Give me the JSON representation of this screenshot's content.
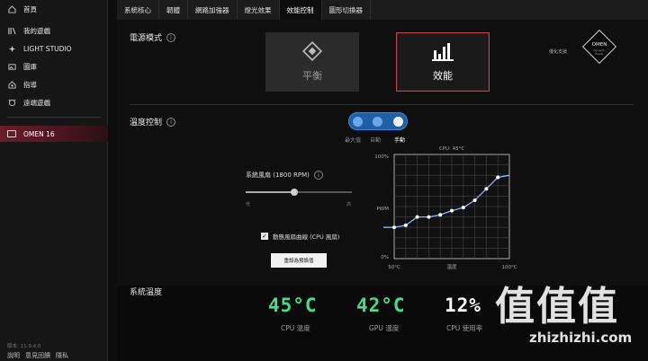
{
  "sidebar": {
    "items": [
      {
        "label": "首頁",
        "icon": "home-icon"
      },
      {
        "label": "我的遊戲",
        "icon": "library-icon"
      },
      {
        "label": "LIGHT STUDIO",
        "icon": "sparkle-icon"
      },
      {
        "label": "圖庫",
        "icon": "gallery-icon"
      },
      {
        "label": "指導",
        "icon": "coach-icon"
      },
      {
        "label": "遠端遊戲",
        "icon": "remote-play-icon"
      }
    ],
    "device": "OMEN 16",
    "version": "版本: 11.9.4.0",
    "footer": [
      "說明",
      "意見回饋",
      "隱私"
    ]
  },
  "tabs": [
    "系統核心",
    "韌體",
    "網路加強器",
    "燈光效果",
    "效能控制",
    "圖形切換器"
  ],
  "active_tab_index": 4,
  "power_mode": {
    "title": "電源模式",
    "cards": [
      {
        "label": "平衡",
        "icon": "diamond-icon",
        "selected": false
      },
      {
        "label": "效能",
        "icon": "performance-bars-icon",
        "selected": true
      }
    ],
    "brand_text": "優化支援",
    "brand_logo_text": "OMEN Dynamic Power"
  },
  "temp_control": {
    "title": "溫度控制",
    "modes": [
      "最大值",
      "自動",
      "手動"
    ],
    "active_mode": "手動",
    "fan_label": "系統風扇 (1800 RPM)",
    "slider_value": 0.46,
    "slider_low": "低",
    "slider_high": "高",
    "checkbox_label": "動態風扇曲線 (CPU 風扇)",
    "checkbox_checked": true,
    "reset_button": "重設為預設值"
  },
  "chart_data": {
    "type": "line",
    "title": "CPU: 45°C",
    "y_ticks": [
      "100%",
      "PWM",
      "0%"
    ],
    "x_ticks": [
      "50°C",
      "溫度",
      "100°C"
    ],
    "x": [
      50,
      55,
      60,
      65,
      70,
      75,
      80,
      85,
      90,
      95,
      100
    ],
    "values": [
      30,
      32,
      40,
      40,
      42,
      46,
      49,
      56,
      67,
      78,
      80
    ],
    "ylim": [
      0,
      100
    ],
    "xlim": [
      50,
      100
    ],
    "grid": true
  },
  "system_temp": {
    "title": "系統溫度",
    "metrics": [
      {
        "value": "45°C",
        "label": "CPU 溫度",
        "color": "#3ee08a"
      },
      {
        "value": "42°C",
        "label": "GPU 溫度",
        "color": "#3ee08a"
      },
      {
        "value": "12%",
        "label": "CPU 使用率",
        "color": "#f4f4f4"
      }
    ]
  },
  "watermark": {
    "glyphs": "值值值",
    "url": "zhizhizhi.com"
  }
}
